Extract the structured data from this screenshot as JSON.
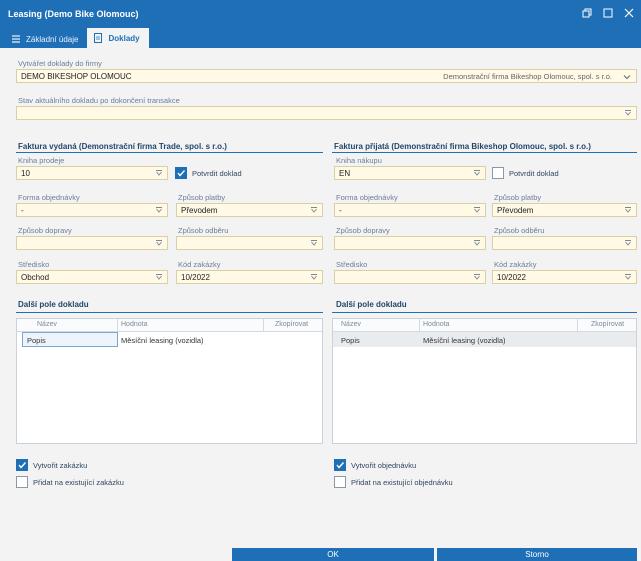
{
  "window": {
    "title": "Leasing (Demo Bike Olomouc)"
  },
  "tabs": [
    {
      "label": "Základní údaje"
    },
    {
      "label": "Doklady"
    }
  ],
  "top": {
    "company_label": "Vytvářet doklady do firmy",
    "company_value": "DEMO BIKESHOP OLOMOUC",
    "company_extra": "Demonstrační firma Bikeshop Olomouc, spol. s r.o.",
    "state_label": "Stav aktuálního dokladu po dokončení transakce",
    "state_value": ""
  },
  "left": {
    "section_title": "Faktura vydaná (Demonstrační firma Trade, spol. s r.o.)",
    "book_label": "Kniha prodeje",
    "book_value": "10",
    "confirm_label": "Potvrdit doklad",
    "confirm_checked": true,
    "order_form_label": "Forma objednávky",
    "order_form_value": "-",
    "payment_label": "Způsob platby",
    "payment_value": "Převodem",
    "transport_label": "Způsob dopravy",
    "transport_value": "",
    "pickup_label": "Způsob odběru",
    "pickup_value": "",
    "center_label": "Středisko",
    "center_value": "Obchod",
    "order_code_label": "Kód zakázky",
    "order_code_value": "10/2022",
    "fields_title": "Další pole dokladu",
    "grid": {
      "columns": [
        "Název",
        "Hodnota",
        "Zkopírovat"
      ],
      "rows": [
        {
          "name": "Popis",
          "value": "Měsíční leasing (vozidla)"
        }
      ]
    },
    "create_label": "Vytvořit zakázku",
    "create_checked": true,
    "add_label": "Přidat na existující zakázku",
    "add_checked": false
  },
  "right": {
    "section_title": "Faktura přijatá (Demonstrační firma Bikeshop Olomouc, spol. s r.o.)",
    "book_label": "Kniha nákupu",
    "book_value": "EN",
    "confirm_label": "Potvrdit doklad",
    "confirm_checked": false,
    "order_form_label": "Forma objednávky",
    "order_form_value": "-",
    "payment_label": "Způsob platby",
    "payment_value": "Převodem",
    "transport_label": "Způsob dopravy",
    "transport_value": "",
    "pickup_label": "Způsob odběru",
    "pickup_value": "",
    "center_label": "Středisko",
    "center_value": "",
    "order_code_label": "Kód zakázky",
    "order_code_value": "10/2022",
    "fields_title": "Další pole dokladu",
    "grid": {
      "columns": [
        "Název",
        "Hodnota",
        "Zkopírovat"
      ],
      "rows": [
        {
          "name": "Popis",
          "value": "Měsíční leasing (vozidla)"
        }
      ]
    },
    "create_label": "Vytvořit objednávku",
    "create_checked": true,
    "add_label": "Přidat na existující objednávku",
    "add_checked": false
  },
  "footer": {
    "ok_label": "OK",
    "cancel_label": "Storno"
  },
  "colors": {
    "accent": "#1f6fb7",
    "field_bg": "#fff9e5"
  }
}
